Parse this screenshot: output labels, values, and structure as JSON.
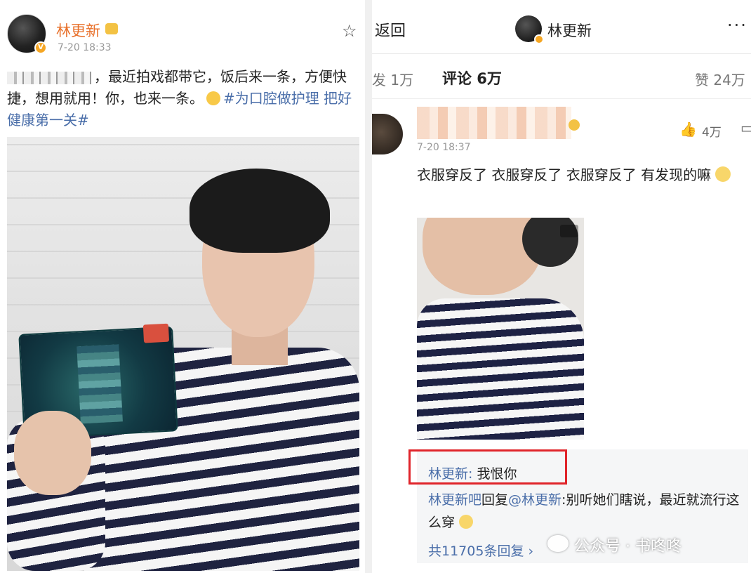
{
  "left_post": {
    "author": "林更新",
    "time": "7-20 18:33",
    "text_before_tag": "，最近拍戏都带它，饭后来一条，方便快捷，想用就用！你，也来一条。",
    "hashtag": "#为口腔做护理 把好健康第一关#",
    "star_icon": "star-outline"
  },
  "right_screen": {
    "back_label": "返回",
    "title": "林更新",
    "more_label": "···",
    "tabs": {
      "repost": "发 1万",
      "comments": "评论 6万",
      "likes": "赞 24万"
    },
    "comment": {
      "time": "7-20 18:37",
      "likes": "4万",
      "text": "衣服穿反了 衣服穿反了 衣服穿反了 有发现的嘛",
      "replies": [
        {
          "user": "林更新",
          "sep": ": ",
          "text": "我恨你"
        },
        {
          "user": "林更新吧",
          "mid": "回复",
          "mention": "@林更新",
          "text": ":别听她们瞎说，最近就流行这么穿"
        }
      ],
      "reply_count": "共11705条回复 ›"
    }
  },
  "watermark": "公众号 · 书咚咚",
  "colors": {
    "author_orange": "#e8702a",
    "link_blue": "#4a6ea9",
    "highlight_red": "#e0242a"
  }
}
